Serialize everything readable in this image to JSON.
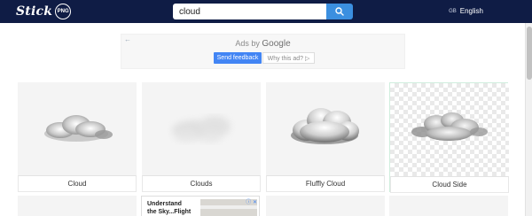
{
  "header": {
    "logo_text": "Stick",
    "logo_badge": "PNG",
    "search_value": "cloud",
    "language_flag": "GB",
    "language_label": "English"
  },
  "ad": {
    "back_arrow": "←",
    "ads_by": "Ads by",
    "google": "Google",
    "send_feedback": "Send feedback",
    "why_this_ad": "Why this ad? ▷"
  },
  "cards": [
    {
      "label": "Cloud"
    },
    {
      "label": "Clouds"
    },
    {
      "label": "Fluffly Cloud"
    },
    {
      "label": "Cloud Side"
    }
  ],
  "inline_ad": {
    "text_line1": "Understand",
    "text_line2": "the Sky...Flight",
    "icons": "ⓘ ✕"
  },
  "colors": {
    "header_bg": "#0f1c45",
    "accent": "#3b8fe0",
    "ad_button": "#4285f4"
  }
}
